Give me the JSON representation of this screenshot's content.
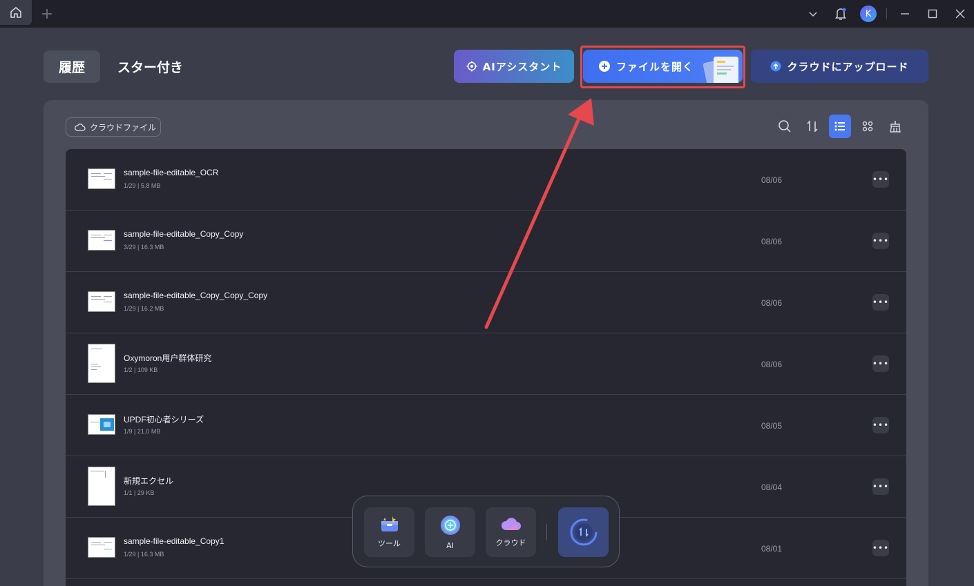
{
  "titlebar": {
    "avatar_letter": "K"
  },
  "header": {
    "tab_history": "履歴",
    "tab_starred": "スター付き",
    "ai_assistant_label": "AIアシスタント",
    "open_file_label": "ファイルを開く",
    "upload_cloud_label": "クラウドにアップロード"
  },
  "panel": {
    "cloud_files_label": "クラウドファイル"
  },
  "files": [
    {
      "name": "sample-file-editable_OCR",
      "meta": "1/29 | 5.8 MB",
      "date": "08/06",
      "orientation": "landscape"
    },
    {
      "name": "sample-file-editable_Copy_Copy",
      "meta": "3/29 | 16.3 MB",
      "date": "08/06",
      "orientation": "landscape"
    },
    {
      "name": "sample-file-editable_Copy_Copy_Copy",
      "meta": "1/29 | 16.2 MB",
      "date": "08/06",
      "orientation": "landscape"
    },
    {
      "name": "Oxymoron用户群体研究",
      "meta": "1/2 | 109 KB",
      "date": "08/06",
      "orientation": "portrait"
    },
    {
      "name": "UPDF初心者シリーズ",
      "meta": "1/9 | 21.0 MB",
      "date": "08/05",
      "orientation": "landscape"
    },
    {
      "name": "新規エクセル",
      "meta": "1/1 | 29 KB",
      "date": "08/04",
      "orientation": "portrait"
    },
    {
      "name": "sample-file-editable_Copy1",
      "meta": "1/29 | 16.3 MB",
      "date": "08/01",
      "orientation": "landscape"
    }
  ],
  "dock": {
    "tools_label": "ツール",
    "ai_label": "AI",
    "cloud_label": "クラウド"
  },
  "colors": {
    "accent": "#4a78f0",
    "highlight": "#e5484d"
  }
}
